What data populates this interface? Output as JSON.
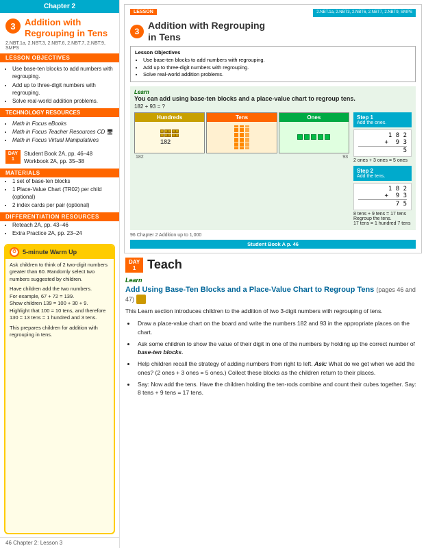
{
  "left": {
    "chapter": "Chapter 2",
    "lesson_num": "3",
    "lesson_title_line1": "Addition with",
    "lesson_title_line2": "Regrouping in Tens",
    "common_core": "2.NBT.1a, 2.NBT.3, 2.NBT.6, 2.NBT.7, 2.NBT.9, SMPS",
    "lesson_objectives_header": "LESSON OBJECTIVES",
    "lesson_objectives": [
      "Use base-ten blocks to add numbers with regrouping.",
      "Add up to three-digit numbers with regrouping.",
      "Solve real-world addition problems."
    ],
    "technology_header": "TECHNOLOGY RESOURCES",
    "technology": [
      "Math in Focus eBooks",
      "Math in Focus Teacher Resources CD",
      "Math in Focus Virtual Manipulatives"
    ],
    "day": "DAY",
    "day_num": "1",
    "day_text_line1": "Student Book 2A, pp. 46–48",
    "day_text_line2": "Workbook 2A, pp. 35–38",
    "materials_header": "MATERIALS",
    "materials": [
      "1 set of base-ten blocks",
      "1 Place-Value Chart (TR02) per child (optional)",
      "2 index cards per pair (optional)"
    ],
    "diff_header": "DIFFERENTIATION RESOURCES",
    "diff": [
      "Reteach 2A, pp. 43–46",
      "Extra Practice 2A, pp. 23–24"
    ],
    "warmup_title": "5-minute Warm Up",
    "warmup_bullets": [
      "Ask children to think of 2 two-digit numbers greater than 60. Randomly select two numbers suggested by children.",
      "Have children add the two numbers.\nFor example, 67 + 72 = 139.\nShow children 139 = 100 + 30 + 9.\nHighlight that 100 = 10 tens, and therefore 130 = 13 tens = 1 hundred and 3 tens.",
      "This prepares children for addition with regrouping in tens."
    ],
    "footer": "46   Chapter 2: Lesson 3"
  },
  "textbook": {
    "standards": "2.NBT.1a, 2.NBT3,\n2.NBT6, 2.NBT7,\n2.NBT9, SMPS",
    "lesson_num": "3",
    "lesson_title": "Addition with Regrouping\nin Tens",
    "objectives_title": "Lesson Objectives",
    "objectives": [
      "Use base-ten blocks to add numbers with regrouping.",
      "Add up to three-digit numbers with regrouping.",
      "Solve real-world addition problems."
    ],
    "learn_label": "Learn",
    "learn_title": "You can add using base-ten blocks and a place-value chart to regroup tens.",
    "equation": "182 + 93 = ?",
    "pv_headers": [
      "Hundreds",
      "Tens",
      "Ones"
    ],
    "step1_title": "Step 1",
    "step1_desc": "Add the ones.",
    "step1_math": "  1 8 2\n+ 9 3\n     5",
    "step1_note": "2 ones + 3 ones = 5 ones",
    "step2_title": "Step 2",
    "step2_desc": "Add the tens.",
    "step2_math": "  1 8 2\n+ 9 3\n  7 5",
    "step2_note": "8 tens + 9 tens = 17 tens\nRegroup the tens.\n17 tens = 1 hundred 7 tens",
    "tb_page": "96   Chapter 2  Addition up to 1,000",
    "student_book": "Student Book A  p. 46"
  },
  "teach": {
    "day_label": "DAY",
    "day_num": "1",
    "teach_title": "Teach",
    "learn_label": "Learn",
    "section_title": "Add Using Base-Ten Blocks and a Place-Value Chart to Regroup Tens",
    "pages_ref": "(pages 46 and 47)",
    "intro": "This Learn section introduces children to the addition of two 3-digit numbers with regrouping of tens.",
    "bullets": [
      "Draw a place-value chart on the board and write the numbers 182 and 93 in the appropriate places on the chart.",
      "Ask some children to show the value of their digit in one of the numbers by holding up the correct number of base-ten blocks.",
      "Help children recall the strategy of adding numbers from right to left. Ask: What do we get when we add the ones? (2 ones + 3 ones = 5 ones.) Collect these blocks as the children return to their places.",
      "Say: Now add the tens. Have the children holding the ten-rods combine and count their cubes together. Say: 8 tens + 9 tens = 17 tens."
    ]
  }
}
